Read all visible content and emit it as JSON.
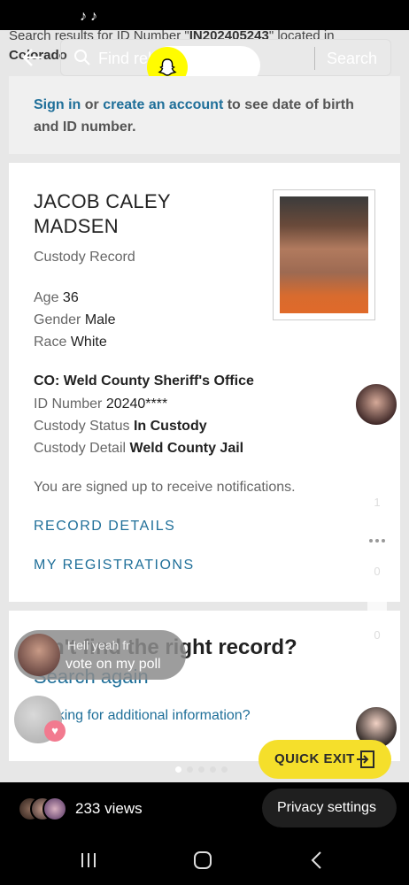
{
  "status_bar": {
    "icons": [
      "tiktok-icon",
      "tiktok-icon"
    ]
  },
  "browser": {
    "results_prefix": "Search results for ID Number \"",
    "results_id": "IN202405243",
    "results_suffix": "\" located in",
    "state": "Colorado",
    "find_placeholder": "Find rel",
    "search_label": "Search"
  },
  "signin": {
    "sign_in": "Sign in",
    "or": " or ",
    "create_account": "create an account",
    "rest": " to see date of birth and ID number."
  },
  "record": {
    "name": "JACOB CALEY MADSEN",
    "type": "Custody Record",
    "age_label": "Age",
    "age": "36",
    "gender_label": "Gender",
    "gender": "Male",
    "race_label": "Race",
    "race": "White",
    "agency": "CO: Weld County Sheriff's Office",
    "id_label": "ID Number",
    "id": "20240****",
    "status_label": "Custody Status",
    "status": "In Custody",
    "detail_label": "Custody Detail",
    "detail": "Weld County Jail",
    "notify": "You are signed up to receive notifications.",
    "record_details": "RECORD DETAILS",
    "my_registrations": "MY REGISTRATIONS"
  },
  "search_card": {
    "cant_find": "n't find the right record?",
    "search_again": "Search again",
    "additional": "Looking for additional information?"
  },
  "poll": {
    "line1": "Hell yeah fr",
    "line2": "vote on my poll"
  },
  "side_actions": {
    "likes": "1",
    "comments": "0",
    "saves": "0"
  },
  "quick_exit": {
    "label": "QUICK EXIT"
  },
  "pager": {
    "count": 5,
    "active": 0
  },
  "footer": {
    "views": "233 views",
    "privacy": "Privacy settings"
  },
  "colors": {
    "link": "#1f6f99",
    "quick_exit": "#f5df2b",
    "snap_yellow": "#fffc00"
  }
}
